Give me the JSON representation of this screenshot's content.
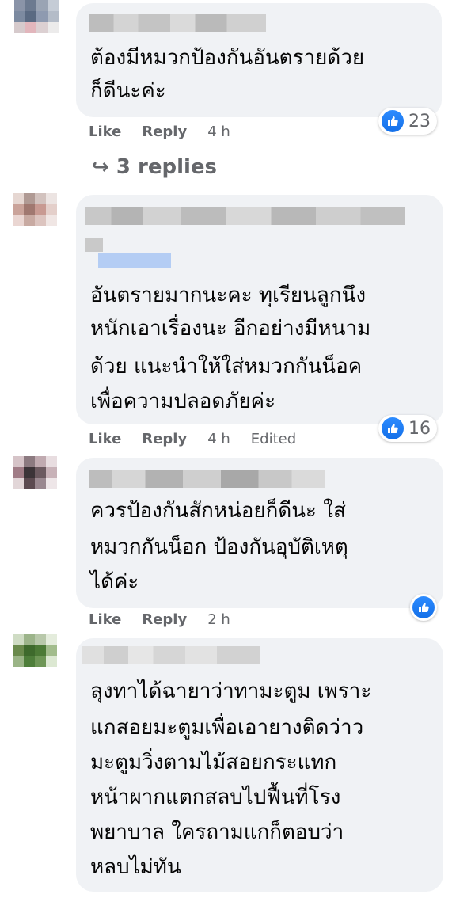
{
  "comments": [
    {
      "text_lines": [
        "ต้องมีหมวกป้องกันอันตรายด้วย",
        "ก็ดีนะค่ะ"
      ],
      "like_label": "Like",
      "reply_label": "Reply",
      "time": "4 h",
      "edited": "",
      "reaction_count": "23",
      "replies_label": "3 replies",
      "avatar_colors": [
        "#8a94a8",
        "#6c7a90",
        "#9aa4b4",
        "#c5ccd6",
        "#7c8aa0",
        "#5a6a82",
        "#8e9ab0",
        "#b4bcc8",
        "#d6cacc",
        "#e2b6bc",
        "#dcd0d2",
        "#ecebeb"
      ]
    },
    {
      "text_lines": [
        "อันตรายมากนะคะ ทุเรียนลูกนึง",
        "หนักเอาเรื่องนะ อีกอย่างมีหนาม",
        "ด้วย แนะนำให้ใส่หมวกกันน็อค",
        "เพื่อความปลอดภัยค่ะ"
      ],
      "like_label": "Like",
      "reply_label": "Reply",
      "time": "4 h",
      "edited": "Edited",
      "reaction_count": "16",
      "avatar_colors": [
        "#e6d7d2",
        "#b09a94",
        "#d2c2be",
        "#ece4e2",
        "#caa39a",
        "#a07870",
        "#c89a92",
        "#e4cfca",
        "#ead6d2",
        "#c8aaa2",
        "#dcc4bf",
        "#f0e6e4"
      ]
    },
    {
      "text_lines": [
        "ควรป้องกันสักหน่อยก็ดีนะ ใส่",
        "หมวกกันน็อก ป้องกันอุบัติเหตุ",
        "ได้ค่ะ"
      ],
      "like_label": "Like",
      "reply_label": "Reply",
      "time": "2 h",
      "edited": "",
      "reaction_count": "",
      "avatar_colors": [
        "#d6c4c8",
        "#8c7a80",
        "#c0aab0",
        "#e8dde0",
        "#a07c86",
        "#3c3438",
        "#6c5a60",
        "#c8b2b8",
        "#e2d6d8",
        "#5c4a50",
        "#9a8890",
        "#eee6e8"
      ]
    },
    {
      "text_lines": [
        "ลุงทาได้ฉายาว่าทามะตูม เพราะ",
        "แกสอยมะตูมเพื่อเอายางติดว่าว",
        "มะตูมวิ่งตามไม้สอยกระแทก",
        "หน้าผากแตกสลบไปฟื้นที่โรง",
        "พยาบาล ใครถามแกก็ตอบว่า",
        "หลบไม่ทัน"
      ],
      "avatar_colors": [
        "#cfdcc4",
        "#9cb48a",
        "#b8c8aa",
        "#e4ecdc",
        "#6a8a4c",
        "#3e6a2c",
        "#4c7a36",
        "#a2bc8c",
        "#9ab486",
        "#4e7e3a",
        "#6e9656",
        "#dce8d2"
      ]
    }
  ]
}
